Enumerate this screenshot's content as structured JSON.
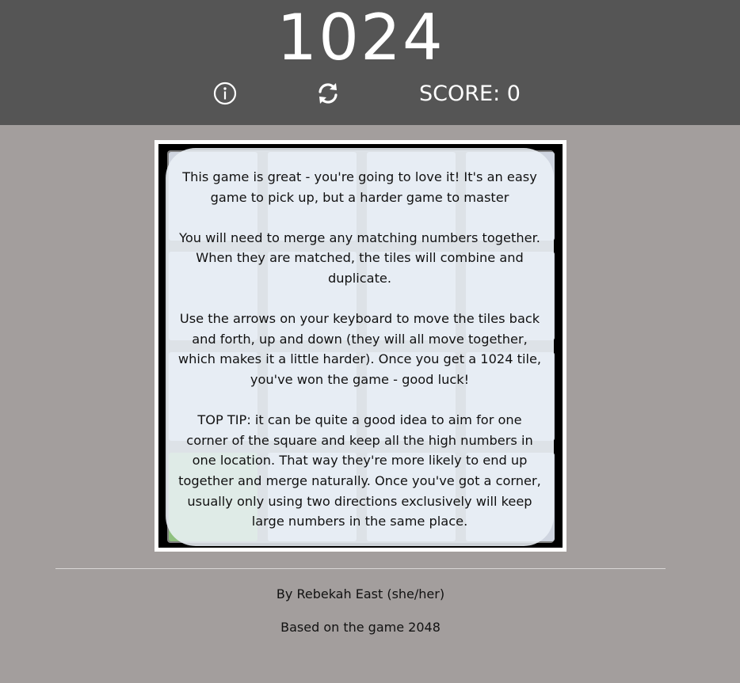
{
  "header": {
    "title": "1024",
    "score_label": "SCORE: 0",
    "info_icon": "info-circle-icon",
    "restart_icon": "refresh-icon"
  },
  "board": {
    "size": 4,
    "highlight_cell": "bottom-left",
    "highlight_color": "#8fc07f"
  },
  "instructions": {
    "p1": "This game is great - you're going to love it! It's an easy game to pick up, but a harder game to master",
    "p2": "You will need to merge any matching numbers together. When they are matched, the tiles will combine and duplicate.",
    "p3": "Use the arrows on your keyboard to move the tiles back and forth, up and down (they will all move together, which makes it a little harder). Once you get a 1024 tile, you've won the game - good luck!",
    "p4": "TOP TIP: it can be quite a good idea to aim for one corner of the square and keep all the high numbers in one location. That way they're more likely to end up together and merge naturally. Once you've got a corner, usually only using two directions exclusively will keep large numbers in the same place."
  },
  "footer": {
    "author": "By Rebekah East (she/her)",
    "based_on": "Based on the game 2048"
  },
  "colors": {
    "header_bg": "#555555",
    "page_bg": "#a39e9d",
    "board_bg": "#000000"
  }
}
